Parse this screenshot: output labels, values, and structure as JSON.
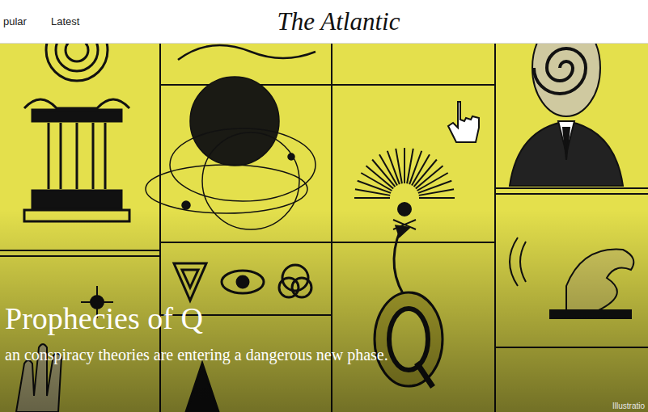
{
  "header": {
    "nav": [
      {
        "label": "pular"
      },
      {
        "label": "Latest"
      }
    ],
    "logo": "The Atlantic"
  },
  "hero": {
    "headline": "Prophecies of Q",
    "dek": "an conspiracy theories are entering a dangerous new phase.",
    "credit": "Illustratio"
  }
}
